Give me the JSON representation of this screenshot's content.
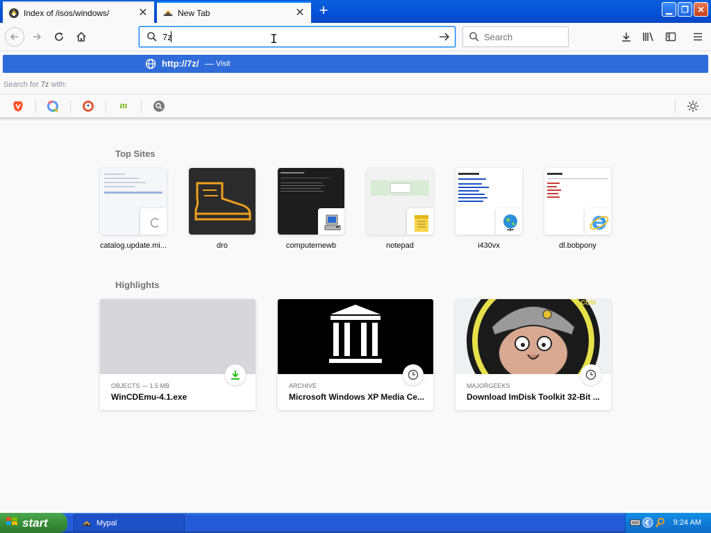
{
  "tabs": [
    {
      "title": "Index of /isos/windows/",
      "active": false
    },
    {
      "title": "New Tab",
      "active": true
    }
  ],
  "urlbar": {
    "value": "7z"
  },
  "searchbar": {
    "placeholder": "Search"
  },
  "dropdown": {
    "visit": {
      "url": "http://7z/",
      "separator": "—",
      "action": "Visit"
    },
    "search_with": {
      "prefix": "Search for",
      "term": "7z",
      "suffix": "with:"
    },
    "engines": [
      "brave-engine",
      "qwant-engine",
      "duckduckgo-engine",
      "mojeek-engine",
      "search-engine"
    ]
  },
  "top_sites": {
    "heading": "Top Sites",
    "items": [
      {
        "label": "catalog.update.mi..."
      },
      {
        "label": "dro"
      },
      {
        "label": "computernewb"
      },
      {
        "label": "notepad"
      },
      {
        "label": "i430vx"
      },
      {
        "label": "dl.bobpony"
      }
    ]
  },
  "highlights": {
    "heading": "Highlights",
    "items": [
      {
        "meta": "OBJECTS — 1.5 MB",
        "title": "WinCDEmu-4.1.exe"
      },
      {
        "meta": "ARCHIVE",
        "title": "Microsoft Windows XP Media Ce..."
      },
      {
        "meta": "MAJORGEEKS",
        "title": "Download ImDisk Toolkit 32-Bit ..."
      }
    ]
  },
  "taskbar": {
    "start_label": "start",
    "task_label": "Mypal",
    "clock": "9:24 AM"
  },
  "colors": {
    "accent": "#0a84ff",
    "visit_row": "#2f6bd9",
    "taskbar": "#245dd7",
    "start_button": "#3a8f3a"
  }
}
